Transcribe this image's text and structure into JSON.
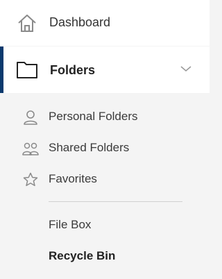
{
  "nav": {
    "dashboard": {
      "label": "Dashboard",
      "icon": "home-icon"
    },
    "folders": {
      "label": "Folders",
      "icon": "folder-icon",
      "expanded": true
    },
    "sub_items": [
      {
        "label": "Personal Folders",
        "icon": "person-icon"
      },
      {
        "label": "Shared Folders",
        "icon": "people-icon"
      },
      {
        "label": "Favorites",
        "icon": "star-icon"
      }
    ],
    "extra_items": [
      {
        "label": "File Box"
      },
      {
        "label": "Recycle Bin"
      }
    ]
  },
  "colors": {
    "active_bar": "#0b3a6e",
    "background": "#f4f4f4",
    "icon": "#8a8a8a"
  }
}
